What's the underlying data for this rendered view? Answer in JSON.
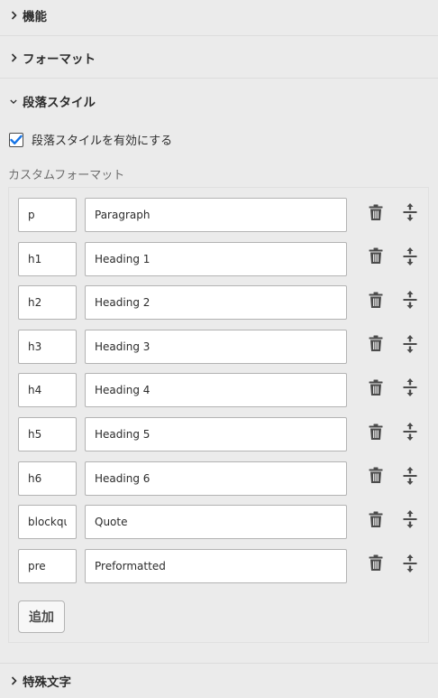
{
  "sections": [
    {
      "title": "機能",
      "expanded": false
    },
    {
      "title": "フォーマット",
      "expanded": false
    },
    {
      "title": "段落スタイル",
      "expanded": true
    },
    {
      "title": "特殊文字",
      "expanded": false
    }
  ],
  "paragraph_styles": {
    "enable_label": "段落スタイルを有効にする",
    "enabled": true,
    "custom_formats_label": "カスタムフォーマット",
    "formats": [
      {
        "tag": "p",
        "name": "Paragraph"
      },
      {
        "tag": "h1",
        "name": "Heading 1"
      },
      {
        "tag": "h2",
        "name": "Heading 2"
      },
      {
        "tag": "h3",
        "name": "Heading 3"
      },
      {
        "tag": "h4",
        "name": "Heading 4"
      },
      {
        "tag": "h5",
        "name": "Heading 5"
      },
      {
        "tag": "h6",
        "name": "Heading 6"
      },
      {
        "tag": "blockqu",
        "name": "Quote"
      },
      {
        "tag": "pre",
        "name": "Preformatted"
      }
    ],
    "add_label": "追加"
  },
  "icons": {
    "collapsed": "chevron-right-icon",
    "expanded": "chevron-down-icon",
    "delete": "trash-icon",
    "reorder": "move-vertical-icon",
    "checkbox": "checkmark-icon"
  },
  "colors": {
    "background": "#ebebeb",
    "checkmark": "#1473e6",
    "text": "#2c2c2c",
    "muted_text": "#6e6e6e"
  }
}
